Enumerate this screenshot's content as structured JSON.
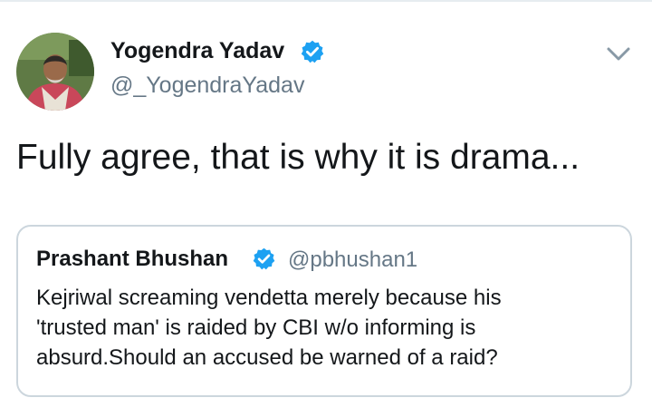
{
  "tweet": {
    "author_name": "Yogendra Yadav",
    "author_handle": "@_YogendraYadav",
    "text": "Fully agree, that is why it is drama..."
  },
  "quoted_tweet": {
    "author_name": "Prashant Bhushan",
    "author_handle": "@pbhushan1",
    "text_lines": [
      "Kejriwal screaming vendetta merely because his",
      "'trusted man' is raided by CBI w/o informing is",
      "absurd.Should an accused be warned of a raid?"
    ]
  },
  "icons": {
    "verified": "verified-badge-icon",
    "menu": "chevron-down-icon"
  },
  "colors": {
    "verified_blue": "#1da1f2",
    "secondary_text": "#657786",
    "card_border": "#ccd6dd"
  }
}
